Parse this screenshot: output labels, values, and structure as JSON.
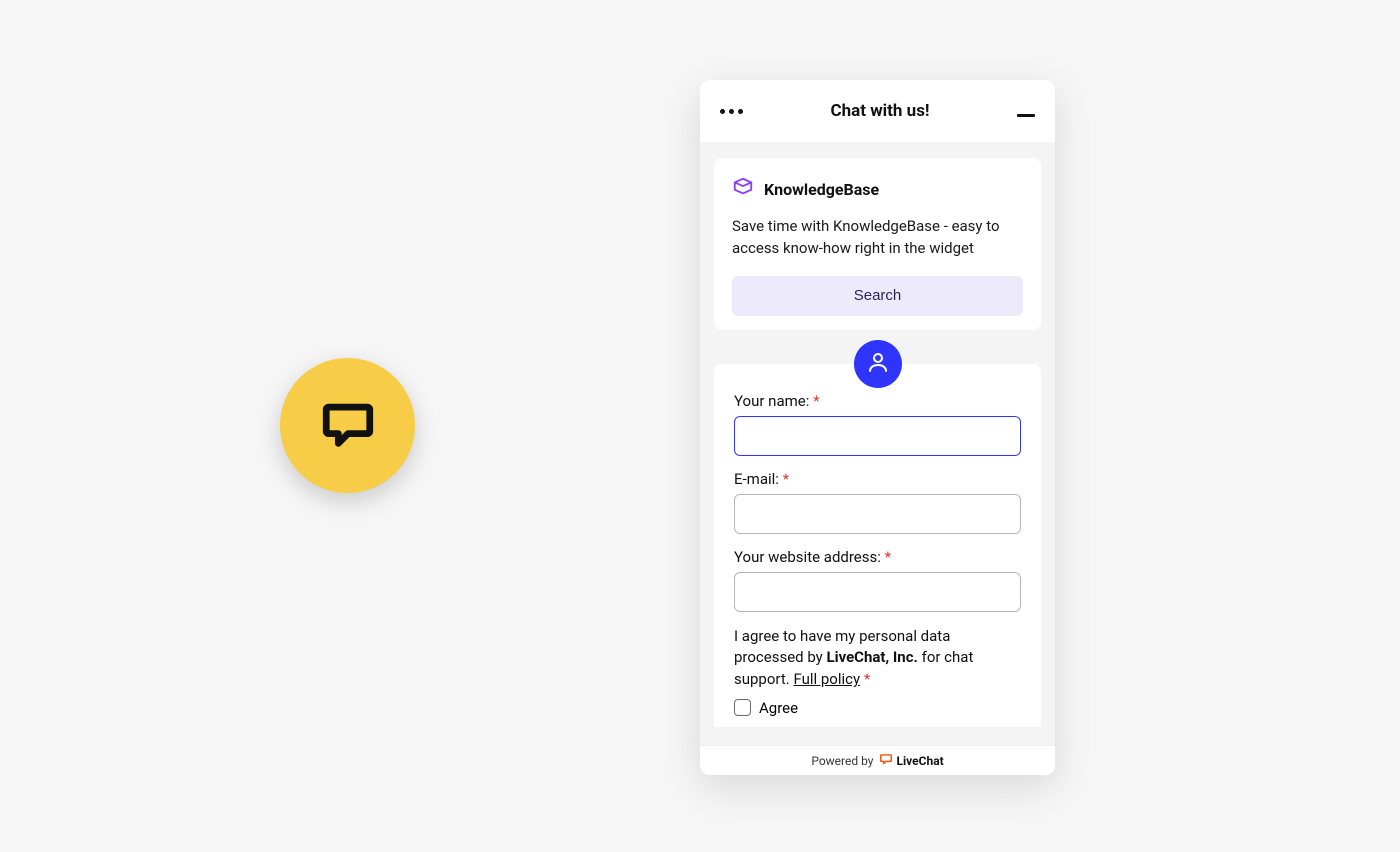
{
  "header": {
    "title": "Chat with us!"
  },
  "kb": {
    "title": "KnowledgeBase",
    "description": "Save time with KnowledgeBase - easy to access know-how right in the widget",
    "search_label": "Search"
  },
  "form": {
    "name_label": "Your name:",
    "email_label": "E-mail:",
    "website_label": "Your website address:",
    "consent_pre": "I agree to have my personal data processed by ",
    "consent_company": "LiveChat, Inc.",
    "consent_post": " for chat support. ",
    "consent_policy": "Full policy",
    "agree_label": "Agree",
    "required_marker": "*"
  },
  "footer": {
    "powered_by": "Powered by",
    "brand": "LiveChat"
  }
}
